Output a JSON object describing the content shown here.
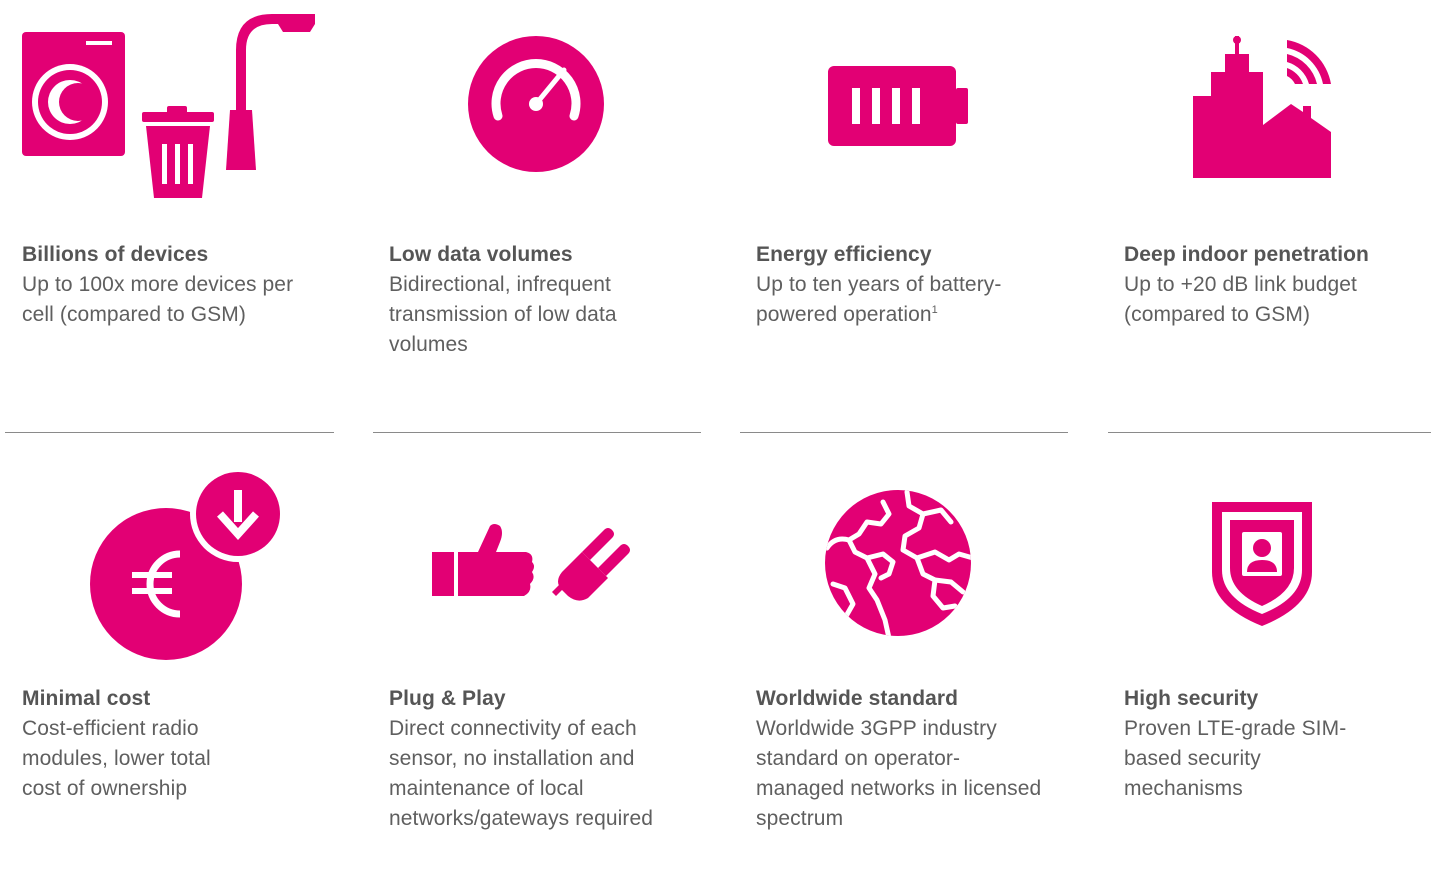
{
  "accent_color": "#E20074",
  "features": [
    {
      "icon": "devices-icon",
      "title": "Billions of devices",
      "description": "Up to 100x more devices per cell (compared to GSM)"
    },
    {
      "icon": "speedometer-icon",
      "title": "Low data volumes",
      "description": "Bidirectional, infrequent transmission of low data volumes"
    },
    {
      "icon": "battery-icon",
      "title": "Energy efficiency",
      "description": "Up to ten years of battery-powered operation",
      "footnote": "1"
    },
    {
      "icon": "building-signal-icon",
      "title": "Deep indoor penetration",
      "description": "Up to +20 dB link budget (compared to GSM)"
    },
    {
      "icon": "euro-cost-down-icon",
      "title": "Minimal cost",
      "description": "Cost-efficient radio modules, lower total cost of ownership"
    },
    {
      "icon": "thumbs-up-plug-icon",
      "title": "Plug & Play",
      "description": "Direct connectivity of each sensor, no installation and maintenance of local networks/gateways required"
    },
    {
      "icon": "globe-icon",
      "title": "Worldwide standard",
      "description": "Worldwide 3GPP industry standard on operator-managed networks in licensed spectrum"
    },
    {
      "icon": "shield-user-icon",
      "title": "High security",
      "description": "Proven LTE-grade SIM-based security mechanisms"
    }
  ]
}
